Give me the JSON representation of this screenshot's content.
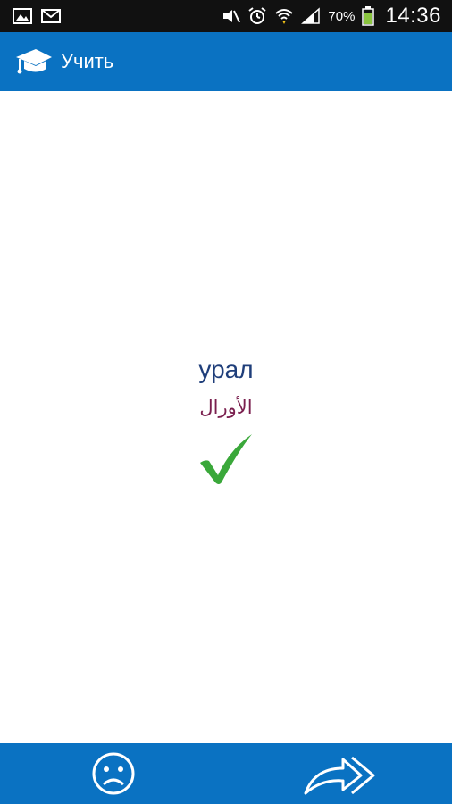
{
  "status_bar": {
    "battery_percent": "70%",
    "time": "14:36",
    "icons": [
      "image-icon",
      "mail-icon",
      "mute-icon",
      "alarm-icon",
      "wifi-icon",
      "signal-icon",
      "battery-icon"
    ]
  },
  "action_bar": {
    "title": "Учить",
    "icon": "graduation-cap-icon"
  },
  "card": {
    "word": "урал",
    "translation": "الأورال",
    "result_icon": "checkmark-icon"
  },
  "bottom_bar": {
    "buttons": [
      "sad-face-icon",
      "forward-arrow-icon"
    ]
  },
  "colors": {
    "accent": "#0a72c2",
    "word": "#1f3e7a",
    "translation": "#7a1f4e",
    "check": "#3aa83a"
  }
}
